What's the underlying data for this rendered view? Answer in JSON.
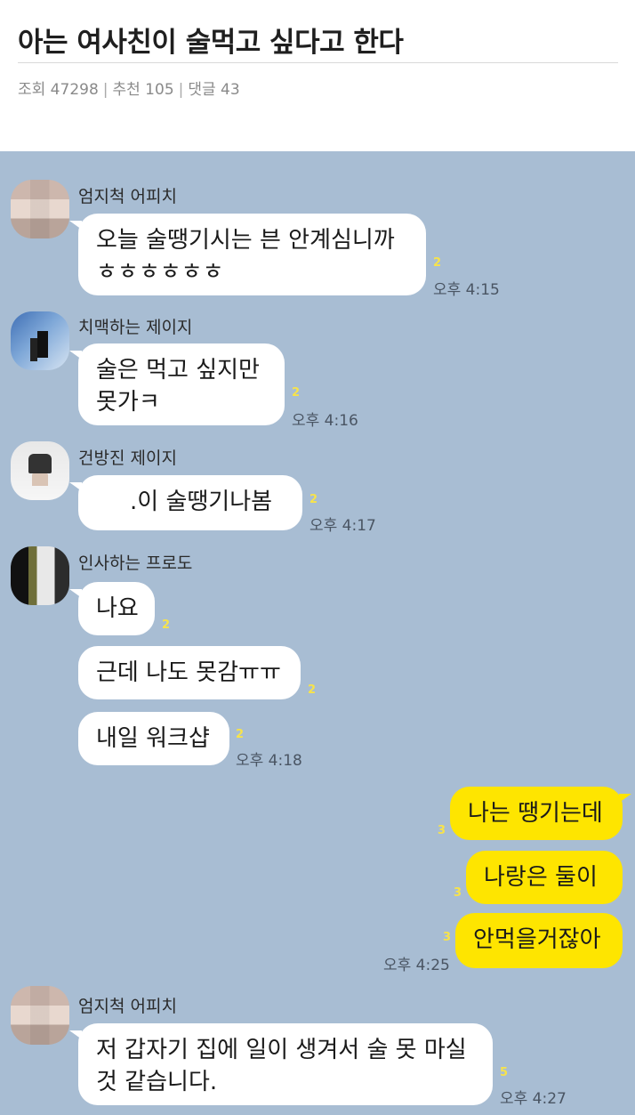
{
  "post": {
    "title": "아는 여사친이 술먹고 싶다고 한다",
    "views_label": "조회 47298",
    "recommend_label": "추천 105",
    "comments_label": "댓글 43"
  },
  "chat": {
    "messages": [
      {
        "sender": "엄지척 어피치",
        "lines": [
          "오늘 술땡기시는 븐 안계심니까",
          "ㅎㅎㅎㅎㅎㅎ"
        ],
        "unread": "2",
        "time": "오후 4:15"
      },
      {
        "sender": "치맥하는 제이지",
        "lines": [
          "술은 먹고 싶지만",
          "못가ㅋ"
        ],
        "unread": "2",
        "time": "오후 4:16"
      },
      {
        "sender": "건방진 제이지",
        "lines": [
          ".이 술땡기나봄"
        ],
        "unread": "2",
        "time": "오후 4:17"
      },
      {
        "sender": "인사하는 프로도",
        "lines": [
          "나요"
        ],
        "unread": "2"
      },
      {
        "lines": [
          "근데 나도 못감ㅠㅠ"
        ],
        "unread": "2"
      },
      {
        "lines": [
          "내일 워크샵"
        ],
        "unread": "2",
        "time": "오후 4:18"
      },
      {
        "mine": true,
        "lines": [
          "나는 땡기는데"
        ],
        "unread": "3"
      },
      {
        "mine": true,
        "lines": [
          "나랑은 둘이"
        ],
        "unread": "3"
      },
      {
        "mine": true,
        "lines": [
          "안먹을거잖아"
        ],
        "unread": "3",
        "time": "오후 4:25"
      },
      {
        "sender": "엄지척 어피치",
        "lines": [
          "저 갑자기 집에 일이 생겨서 술 못 마실",
          "것 같습니다."
        ],
        "unread": "5",
        "time": "오후 4:27"
      }
    ]
  }
}
